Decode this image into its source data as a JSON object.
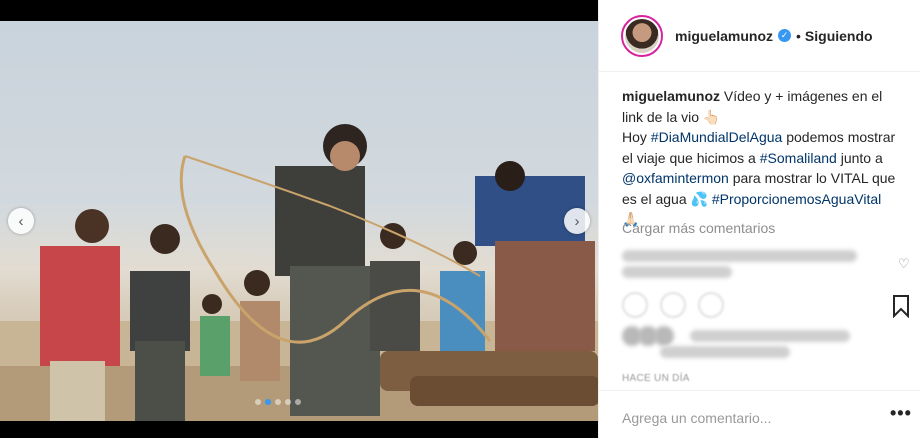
{
  "post": {
    "username": "miguelamunoz",
    "verified_symbol": "✓",
    "separator": "•",
    "follow_status": "Siguiendo"
  },
  "caption": {
    "author": "miguelamunoz",
    "text1": " Vídeo y + imágenes en el link de la vio 👆🏻",
    "text2": "Hoy ",
    "tag1": "#DiaMundialDelAgua",
    "text3": " podemos mostrar el viaje que hicimos a ",
    "tag2": "#Somaliland",
    "text4": " junto a ",
    "tag3": "@oxfamintermon",
    "text5": " para mostrar lo VITAL que es el agua 💦 ",
    "tag4": "#ProporcionemosAguaVital",
    "text6": " 🙏🏻"
  },
  "comments": {
    "load_more": "Cargar más comentarios"
  },
  "meta": {
    "time_ago": "HACE UN DÍA"
  },
  "input": {
    "placeholder": "Agrega un comentario...",
    "more": "•••"
  },
  "carousel": {
    "prev": "‹",
    "next": "›",
    "slide_count": 5,
    "active_index": 1
  },
  "colors": {
    "accent": "#3897f0",
    "hashtag": "#003569",
    "muted": "#8e8e8e"
  }
}
